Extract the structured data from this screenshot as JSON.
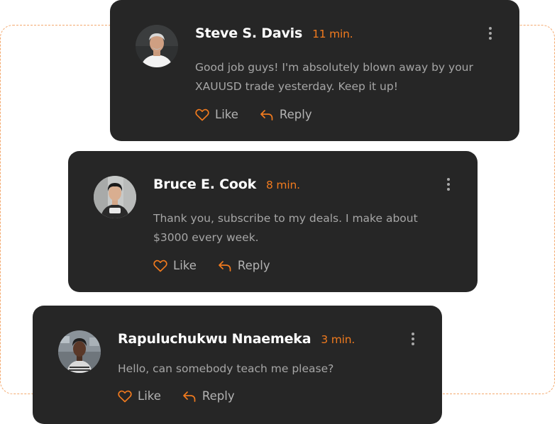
{
  "comments": [
    {
      "name": "Steve S. Davis",
      "time": "11 min.",
      "text": "Good job guys! I'm absolutely blown away by your XAUUSD trade yesterday. Keep it up!",
      "like_label": "Like",
      "reply_label": "Reply"
    },
    {
      "name": "Bruce E. Cook",
      "time": "8 min.",
      "text": "Thank you, subscribe to my deals. I make about $3000 every week.",
      "like_label": "Like",
      "reply_label": "Reply"
    },
    {
      "name": "Rapuluchukwu Nnaemeka",
      "time": "3 min.",
      "text": "Hello, can somebody teach me please?",
      "like_label": "Like",
      "reply_label": "Reply"
    }
  ],
  "icons": {
    "like": "heart-icon",
    "reply": "reply-arrow-icon",
    "menu": "more-vertical-icon"
  },
  "colors": {
    "card_background": "#262626",
    "accent": "#f07a1e",
    "dashed_border": "#f4a96e",
    "name_text": "#ffffff",
    "body_text": "#a6a6a6"
  }
}
